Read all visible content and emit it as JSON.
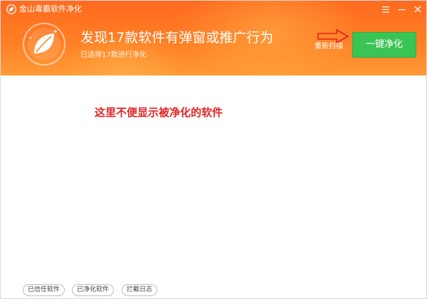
{
  "window": {
    "title": "金山毒霸软件净化",
    "menu_icon": "hamburger-icon",
    "minimize_icon": "minimize-icon",
    "close_icon": "close-icon"
  },
  "header": {
    "logo_icon": "leaf-shield-icon",
    "headline": "发现17款软件有弹窗或推广行为",
    "subline": "已选择17款进行净化",
    "rescan_label": "重新扫描",
    "clean_button_label": "一键净化",
    "arrow_icon": "red-arrow-right-icon"
  },
  "content": {
    "annotation": "这里不便显示被净化的软件"
  },
  "footer": {
    "buttons": [
      "已信任软件",
      "已净化软件",
      "拦截日志"
    ]
  },
  "colors": {
    "header_orange": "#ff7a22",
    "clean_button_green": "#3ac454",
    "annotation_red": "#e02626"
  }
}
